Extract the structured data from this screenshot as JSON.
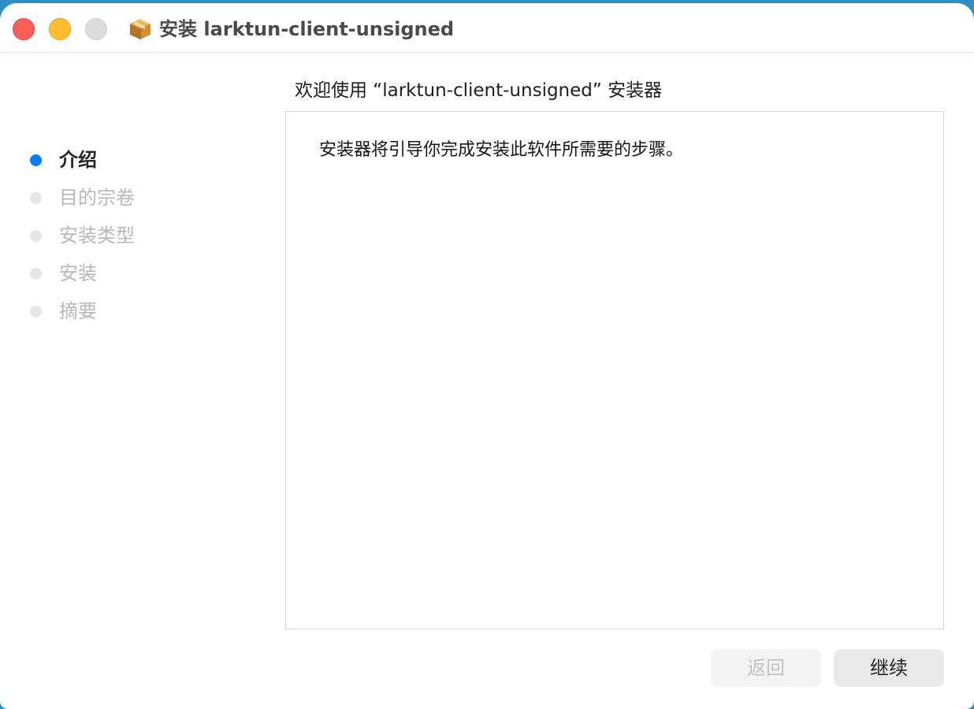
{
  "window": {
    "title": "安装 larktun-client-unsigned",
    "app_icon": "package-box-icon"
  },
  "colors": {
    "close": "#fe5f57",
    "minimize": "#febc2e",
    "zoom": "#dcdcdc",
    "active_step": "#0a7cf5",
    "inactive_step": "#e6e6e6"
  },
  "sidebar": {
    "steps": [
      {
        "label": "介绍",
        "active": true
      },
      {
        "label": "目的宗卷",
        "active": false
      },
      {
        "label": "安装类型",
        "active": false
      },
      {
        "label": "安装",
        "active": false
      },
      {
        "label": "摘要",
        "active": false
      }
    ]
  },
  "main": {
    "heading": "欢迎使用 “larktun-client-unsigned” 安装器",
    "body": "安装器将引导你完成安装此软件所需要的步骤。"
  },
  "buttons": {
    "back": "返回",
    "continue": "继续"
  }
}
